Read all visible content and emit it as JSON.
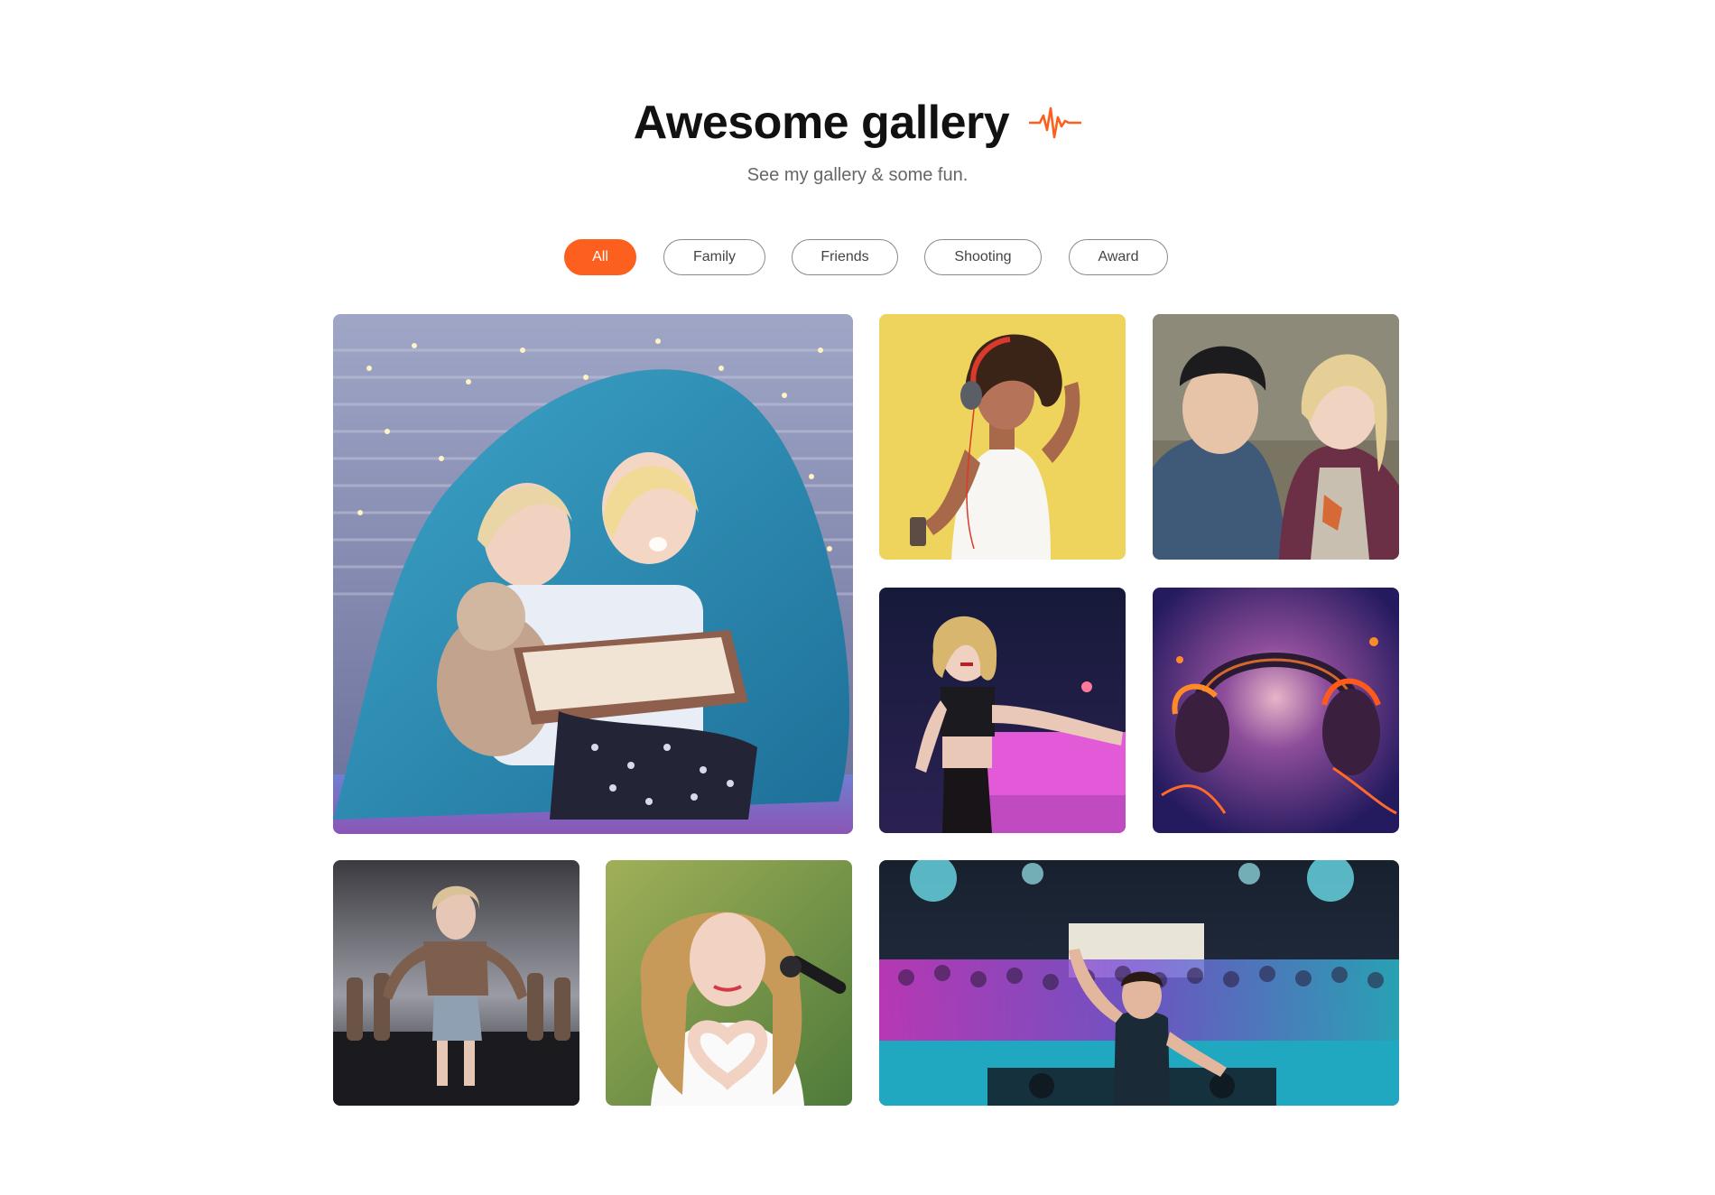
{
  "header": {
    "title": "Awesome gallery",
    "subtitle": "See my gallery & some fun.",
    "icon": "heartbeat-wave-icon",
    "accent_color": "#fc5f1e"
  },
  "filters": [
    {
      "label": "All",
      "active": true
    },
    {
      "label": "Family",
      "active": false
    },
    {
      "label": "Friends",
      "active": false
    },
    {
      "label": "Shooting",
      "active": false
    },
    {
      "label": "Award",
      "active": false
    }
  ],
  "gallery": [
    {
      "name": "photo-mother-daughter-blanket"
    },
    {
      "name": "photo-woman-headphones-yellow"
    },
    {
      "name": "photo-couple-beanie"
    },
    {
      "name": "photo-singer-concert-stage"
    },
    {
      "name": "photo-fiery-headphones"
    },
    {
      "name": "photo-dancer-music-video"
    },
    {
      "name": "photo-singer-heart-hands"
    },
    {
      "name": "photo-dj-crowd-concert"
    }
  ]
}
